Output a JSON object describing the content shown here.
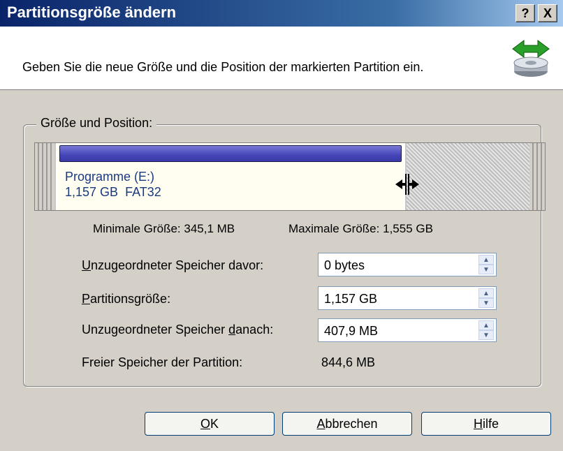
{
  "window": {
    "title": "Partitionsgröße ändern",
    "help_button": "?",
    "close_button": "X"
  },
  "header": {
    "text": "Geben Sie die neue Größe und die Position der markierten Partition ein.",
    "icon": "resize-disk-icon"
  },
  "group": {
    "label": "Größe und Position:",
    "partition": {
      "name": "Programme (E:)",
      "size": "1,157 GB",
      "filesystem": "FAT32"
    },
    "min_size_label": "Minimale Größe:",
    "min_size_value": "345,1 MB",
    "max_size_label": "Maximale Größe:",
    "max_size_value": "1,555 GB"
  },
  "fields": {
    "before": {
      "label_u": "U",
      "label_rest": "nzugeordneter Speicher davor:",
      "value": "0 bytes"
    },
    "size": {
      "label_u": "P",
      "label_rest": "artitionsgröße:",
      "value": "1,157 GB"
    },
    "after": {
      "label_pre": "Unzugeordneter Speicher ",
      "label_u": "d",
      "label_post": "anach:",
      "value": "407,9 MB"
    },
    "free": {
      "label": "Freier Speicher der Partition:",
      "value": "844,6 MB"
    }
  },
  "buttons": {
    "ok": {
      "u": "O",
      "rest": "K"
    },
    "cancel": {
      "u": "A",
      "rest": "bbrechen"
    },
    "help": {
      "u": "H",
      "rest": "ilfe"
    }
  },
  "colors": {
    "title_bar": "#0a246a",
    "partition_bar": "#4545b8",
    "dialog_bg": "#d4d0c8"
  }
}
